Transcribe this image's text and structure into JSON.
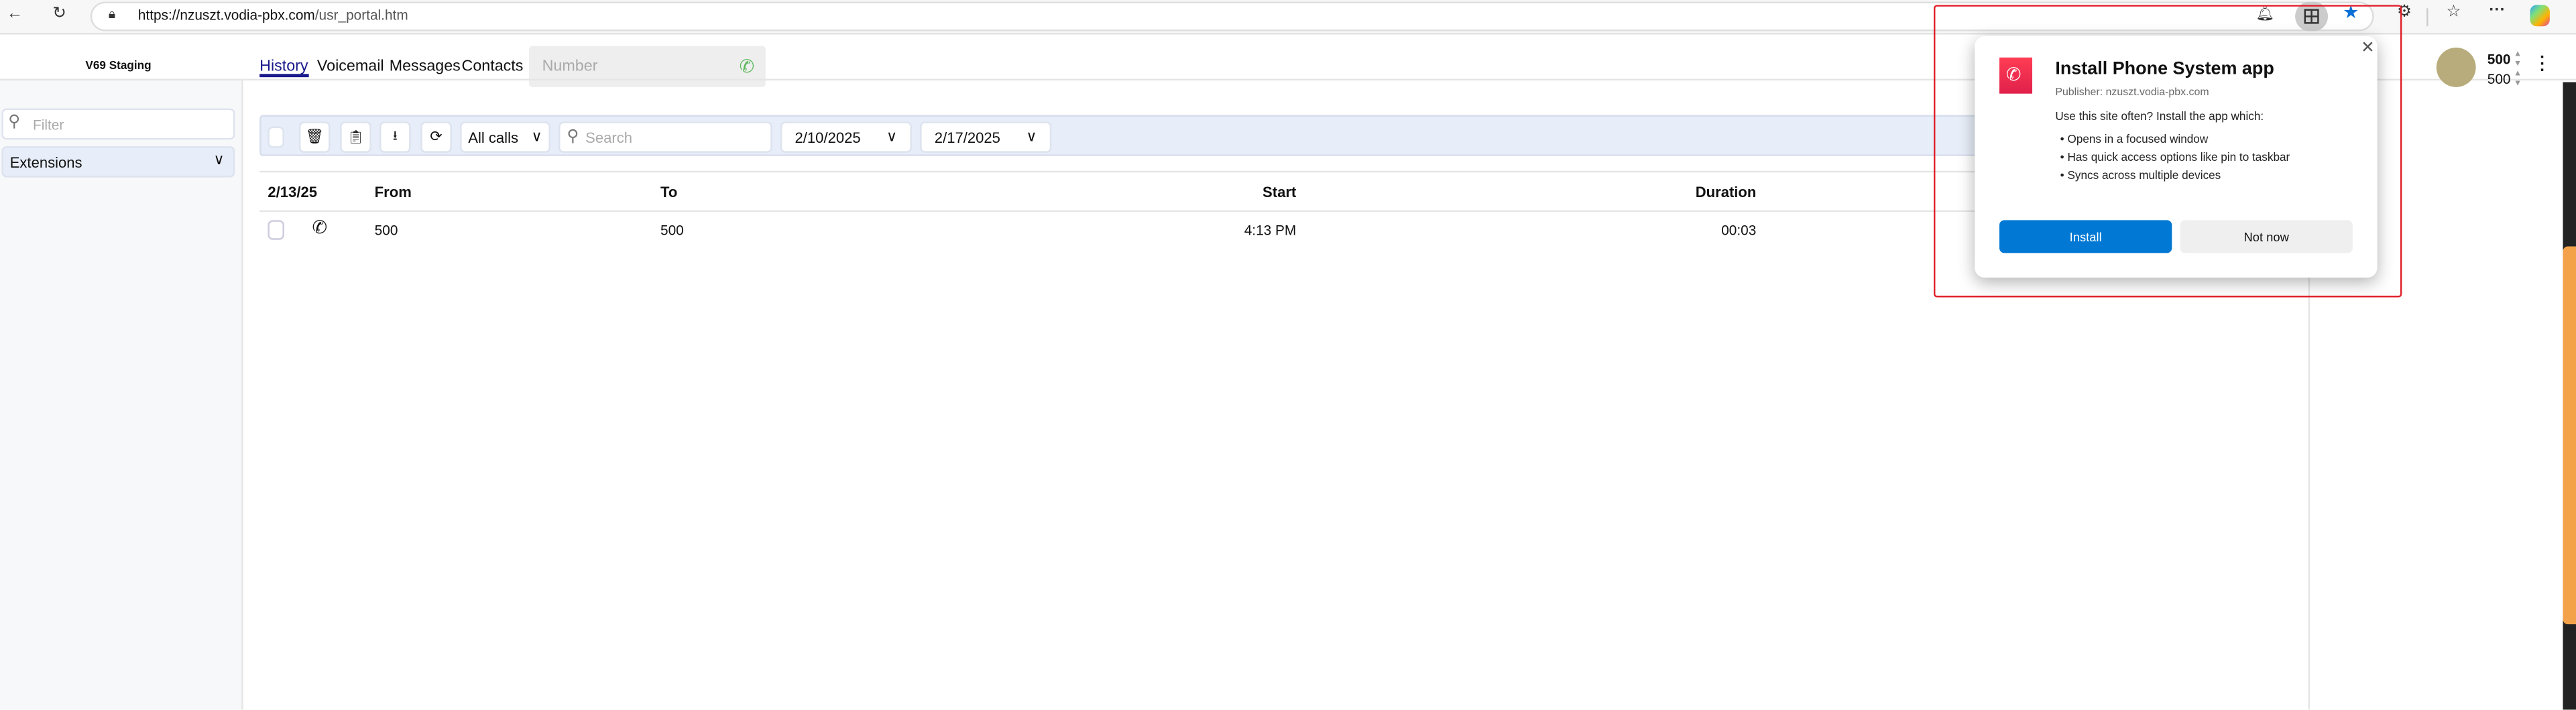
{
  "browser": {
    "url_host": "https://nzuszt.vodia-pbx.com",
    "url_path": "/usr_portal.htm",
    "icons": [
      "back-icon",
      "reload-icon",
      "lock-icon",
      "bell-icon",
      "app-install-icon",
      "star-icon",
      "extensions-icon",
      "favorites-icon",
      "more-icon",
      "copilot-icon"
    ]
  },
  "header": {
    "brand": "V69 Staging",
    "tabs": [
      {
        "label": "History",
        "active": true
      },
      {
        "label": "Voicemail"
      },
      {
        "label": "Messages"
      },
      {
        "label": "Contacts"
      }
    ],
    "number_placeholder": "Number",
    "accent_color": "#1a1a8c"
  },
  "sidebar": {
    "filter_placeholder": "Filter",
    "sections": [
      {
        "label": "Extensions"
      }
    ]
  },
  "toolbar": {
    "filter_select": "All calls",
    "search_placeholder": "Search",
    "date_from": "2/10/2025",
    "date_to": "2/17/2025"
  },
  "table": {
    "date_header": "2/13/25",
    "columns": [
      "From",
      "To",
      "Start",
      "Duration"
    ],
    "rows": [
      {
        "from": "500",
        "to": "500",
        "start": "4:13 PM",
        "duration": "00:03"
      }
    ]
  },
  "user": {
    "line1": "500",
    "line2": "500",
    "avatar_color": "#b8ac7c"
  },
  "popup": {
    "title": "Install Phone System app",
    "publisher": "Publisher: nzuszt.vodia-pbx.com",
    "intro": "Use this site often? Install the app which:",
    "bullets": [
      "Opens in a focused window",
      "Has quick access options like pin to taskbar",
      "Syncs across multiple devices"
    ],
    "install_label": "Install",
    "not_now_label": "Not now",
    "install_color": "#0078d4"
  }
}
